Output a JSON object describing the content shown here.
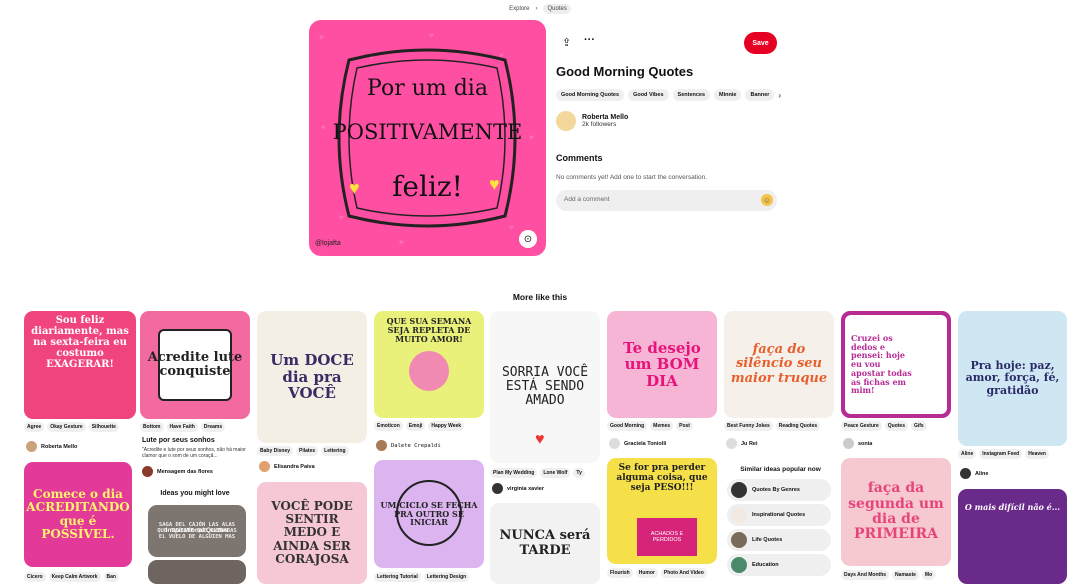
{
  "breadcrumb": [
    "Explore",
    "Quotes"
  ],
  "pin": {
    "title": "Good Morning Quotes",
    "save_label": "Save",
    "image_text": [
      "Por um dia",
      "POSITIVAMENTE",
      "feliz!"
    ],
    "handle": "@lojafta",
    "tags": [
      "Good Morning Quotes",
      "Good Vibes",
      "Sentences",
      "Minnie",
      "Banner"
    ],
    "author": {
      "name": "Roberta Mello",
      "followers": "2k followers"
    },
    "comments_heading": "Comments",
    "comments_empty": "No comments yet! Add one to start the conversation.",
    "comment_placeholder": "Add a comment"
  },
  "more_heading": "More like this",
  "cards": {
    "c1": {
      "text": "Sou feliz diariamente, mas na sexta-feira eu costumo EXAGERAR!",
      "tags": [
        "Agree",
        "Okay Gesture",
        "Silhouette"
      ],
      "user": "Roberta Mello"
    },
    "c2": {
      "text": "Acredite lute conquiste",
      "tags": [
        "Bottom",
        "Have Faith",
        "Dreams"
      ],
      "title": "Lute por seus sonhos",
      "desc": "\"Acredite e lute por seus sonhos, não há maior clamor que o som de um coraçã...",
      "user": "Mensagem das flores"
    },
    "c3": {
      "text": "Um DOCE dia pra VOCÊ",
      "tags": [
        "Baby Disney",
        "Pilates",
        "Lettering"
      ],
      "user": "Elisandra Paiva"
    },
    "c4": {
      "text": "QUE SUA SEMANA SEJA REPLETA DE MUITO AMOR!",
      "tags": [
        "Emoticon",
        "Emoji",
        "Happy Week"
      ],
      "user": "Dalete Crepaldi"
    },
    "c5": {
      "text": "SORRIA VOCÊ ESTÁ SENDO AMADO",
      "tags": [
        "Plan My Wedding",
        "Lone Wolf",
        "Ty"
      ],
      "user": "virginia xavier"
    },
    "c6": {
      "text": "Te desejo um BOM DIA",
      "tags": [
        "Good Morning",
        "Memes",
        "Post"
      ],
      "user": "Graciela Toniolli"
    },
    "c7": {
      "text": "faça do silêncio seu maior truque",
      "tags": [
        "Best Funny Jokes",
        "Reading Quotes"
      ],
      "user": "Ju Rei"
    },
    "c8": {
      "text": "Cruzei os dedos e pensei: hoje eu vou apostar todas as fichas em mim!",
      "tags": [
        "Peace Gesture",
        "Quotes",
        "Gifs"
      ],
      "user": "sonia"
    },
    "c9": {
      "text": "Pra hoje: paz, amor, força, fé, gratidão",
      "tags": [
        "Aline",
        "Instagram Feed",
        "Heaven"
      ],
      "user": "Aline"
    },
    "c10": {
      "text": "Comece o dia ACREDITANDO que é POSSÍVEL.",
      "tags": [
        "Cícero",
        "Keep Calm Artwork",
        "Ban"
      ]
    },
    "c11": {
      "text": "SAGA DEL CAJÓN LAS ALAS QUE TUVISTE QUE CUIDABAS EL VUELO DE ALGUIEN MAS",
      "overlay": "Inspirational Quotes"
    },
    "c12": {
      "text": "VOCÊ PODE SENTIR MEDO E AINDA SER CORAJOSA"
    },
    "c13": {
      "text": "UM CICLO SE FECHA PRA OUTRO SE INICIAR",
      "tags": [
        "Lettering Tutorial",
        "Lettering Design"
      ]
    },
    "c14": {
      "text": "NUNCA será TARDE"
    },
    "c15": {
      "text": "Se for pra perder alguma coisa, que seja PESO!!!",
      "sub": "ACHADOS E PERDIDOS",
      "tags": [
        "Flourish",
        "Humor",
        "Photo And Video"
      ]
    },
    "c16": {
      "text": "faça da segunda um dia de PRIMEIRA",
      "tags": [
        "Days And Months",
        "Namaste",
        "Mo"
      ]
    },
    "c17": {
      "text": "O mais difícil não é..."
    }
  },
  "ideas_heading": "Ideas you might love",
  "similar": {
    "heading": "Similar ideas popular now",
    "items": [
      "Quotes By Genres",
      "Inspirational Quotes",
      "Life Quotes",
      "Education"
    ]
  }
}
